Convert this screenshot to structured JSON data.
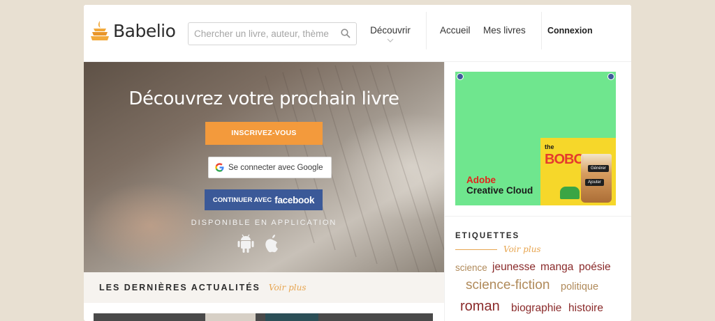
{
  "header": {
    "logo_text": "Babelio",
    "search_placeholder": "Chercher un livre, auteur, thème",
    "nav": {
      "discover": "Découvrir",
      "home": "Accueil",
      "my_books": "Mes livres",
      "login": "Connexion"
    }
  },
  "hero": {
    "title": "Découvrez votre prochain livre",
    "register_button": "INSCRIVEZ-VOUS",
    "google_button": "Se connecter avec Google",
    "facebook_prefix": "CONTINUER AVEC",
    "facebook_brand": "facebook",
    "app_available": "DISPONIBLE EN APPLICATION"
  },
  "news": {
    "title": "LES DERNIÈRES ACTUALITÉS",
    "see_more": "Voir plus"
  },
  "ad": {
    "brand_line1": "Adobe",
    "brand_line2": "Creative Cloud",
    "product_small": "the",
    "product_big": "BOBO",
    "chip1": "Générer",
    "chip2": "Ajouter"
  },
  "etiquettes": {
    "title": "ETIQUETTES",
    "see_more": "Voir plus",
    "tags": [
      {
        "label": "science",
        "color": "#b08a5a"
      },
      {
        "label": "jeunesse",
        "color": "#8a2a2a"
      },
      {
        "label": "manga",
        "color": "#8a2a2a"
      },
      {
        "label": "poésie",
        "color": "#8a2a2a"
      },
      {
        "label": "science-fiction",
        "color": "#b08a5a"
      },
      {
        "label": "politique",
        "color": "#b08a5a"
      },
      {
        "label": "roman",
        "color": "#8a2a2a"
      },
      {
        "label": "biographie",
        "color": "#8a2a2a"
      },
      {
        "label": "histoire",
        "color": "#8a2a2a"
      }
    ]
  },
  "colors": {
    "accent_orange": "#f39a3c",
    "facebook_blue": "#3b5998",
    "tag_dark": "#8a2a2a",
    "tag_light": "#b08a5a",
    "gold": "#e7a550"
  }
}
